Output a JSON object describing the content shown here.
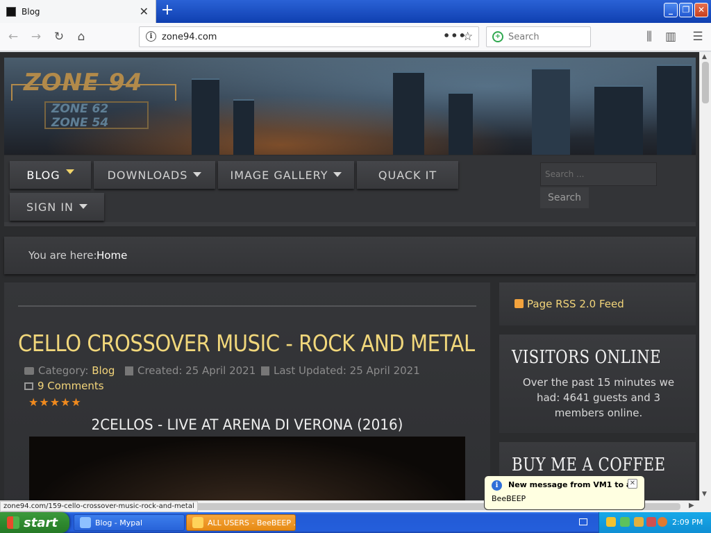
{
  "browser": {
    "tab_title": "Blog",
    "url": "zone94.com",
    "search_placeholder": "Search",
    "status_url": "zone94.com/159-cello-crossover-music-rock-and-metal"
  },
  "site": {
    "logo_main": "ZONE 94",
    "logo_sub1": "ZONE 62",
    "logo_sub2": "ZONE 54",
    "menu": [
      {
        "label": "BLOG",
        "dropdown": true,
        "active": true
      },
      {
        "label": "DOWNLOADS",
        "dropdown": true
      },
      {
        "label": "IMAGE GALLERY",
        "dropdown": true
      },
      {
        "label": "QUACK IT",
        "dropdown": false
      },
      {
        "label": "SIGN IN",
        "dropdown": true
      }
    ],
    "search_placeholder": "Search ...",
    "search_button": "Search",
    "breadcrumb_label": "You are here:",
    "breadcrumb_home": "Home"
  },
  "article": {
    "title": "CELLO CROSSOVER MUSIC - ROCK AND METAL",
    "category_label": "Category:",
    "category": "Blog",
    "created": "Created: 25 April 2021",
    "updated": "Last Updated: 25 April 2021",
    "comments": "9 Comments",
    "rating_stars": 5,
    "stars_text": "★★★★★",
    "subtitle": "2CELLOS - LIVE AT ARENA DI VERONA (2016)"
  },
  "sidebar": {
    "rss": "Page RSS 2.0 Feed",
    "visitors_heading": "VISITORS ONLINE",
    "visitors_text": "Over the past 15 minutes we had: 4641 guests and 3 members online.",
    "coffee_heading": "BUY ME A COFFEE"
  },
  "notification": {
    "title": "New message from VM1 to all",
    "body": "BeeBEEP"
  },
  "taskbar": {
    "start": "start",
    "tasks": [
      "Blog - Mypal",
      "ALL USERS - BeeBEEP ..."
    ],
    "clock": "2:09 PM"
  },
  "colors": {
    "accent_gold": "#f1d77b",
    "page_bg": "#2b2c2e",
    "star_orange": "#f08a1e",
    "taskbar_blue": "#245edb"
  }
}
